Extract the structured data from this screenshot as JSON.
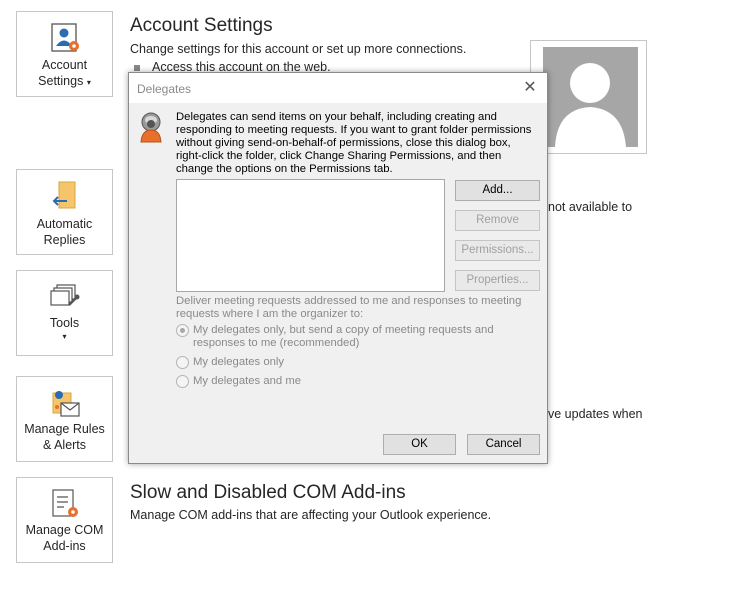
{
  "tiles": {
    "account_settings": "Account\nSettings ▾",
    "account_line1": "Account",
    "account_line2": "Settings",
    "account_chevron": "▾",
    "auto_line1": "Automatic",
    "auto_line2": "Replies",
    "tools_label": "Tools",
    "tools_chevron": "▾",
    "rules_line1": "Manage Rules",
    "rules_line2": "& Alerts",
    "com_line1": "Manage COM",
    "com_line2": "Add-ins"
  },
  "account_section": {
    "title": "Account Settings",
    "description": "Change settings for this account or set up more connections.",
    "bullet": "Access this account on the web."
  },
  "background_fragments": {
    "not_available": "not available to",
    "updates": "ve updates when"
  },
  "com_section": {
    "title": "Slow and Disabled COM Add-ins",
    "description": "Manage COM add-ins that are affecting your Outlook experience."
  },
  "dialog": {
    "title": "Delegates",
    "close": "✕",
    "description": "Delegates can send items on your behalf, including creating and responding to meeting requests. If you want to grant folder permissions without giving send-on-behalf-of permissions, close this dialog box, right-click the folder, click Change Sharing Permissions, and then change the options on the Permissions tab.",
    "buttons": {
      "add": "Add...",
      "remove": "Remove",
      "permissions": "Permissions...",
      "properties": "Properties...",
      "ok": "OK",
      "cancel": "Cancel"
    },
    "meeting_label": "Deliver meeting requests addressed to me and responses to meeting requests where I am the organizer to:",
    "options": [
      {
        "label": "My delegates only, but send a copy of meeting requests and responses to me (recommended)",
        "selected": true
      },
      {
        "label": "My delegates only",
        "selected": false
      },
      {
        "label": "My delegates and me",
        "selected": false
      }
    ]
  },
  "colors": {
    "accent_orange": "#e8702a",
    "accent_blue": "#2b6cb0"
  }
}
